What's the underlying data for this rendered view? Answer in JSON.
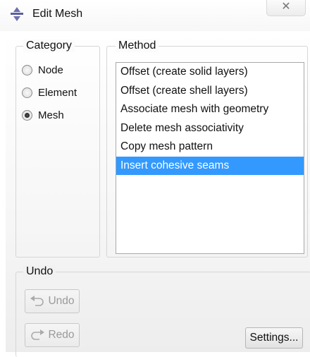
{
  "window": {
    "title": "Edit Mesh",
    "close_label": "✕"
  },
  "category": {
    "legend": "Category",
    "options": [
      {
        "label": "Node",
        "checked": false
      },
      {
        "label": "Element",
        "checked": false
      },
      {
        "label": "Mesh",
        "checked": true
      }
    ]
  },
  "method": {
    "legend": "Method",
    "items": [
      {
        "label": "Offset (create solid layers)",
        "selected": false
      },
      {
        "label": "Offset (create shell layers)",
        "selected": false
      },
      {
        "label": "Associate mesh with geometry",
        "selected": false
      },
      {
        "label": "Delete mesh associativity",
        "selected": false
      },
      {
        "label": "Copy mesh pattern",
        "selected": false
      },
      {
        "label": "Insert cohesive seams",
        "selected": true
      }
    ]
  },
  "undo": {
    "legend": "Undo",
    "undo_label": "Undo",
    "redo_label": "Redo",
    "settings_label": "Settings..."
  },
  "colors": {
    "selection": "#3399ff",
    "disabled_text": "#9a9a9a"
  }
}
